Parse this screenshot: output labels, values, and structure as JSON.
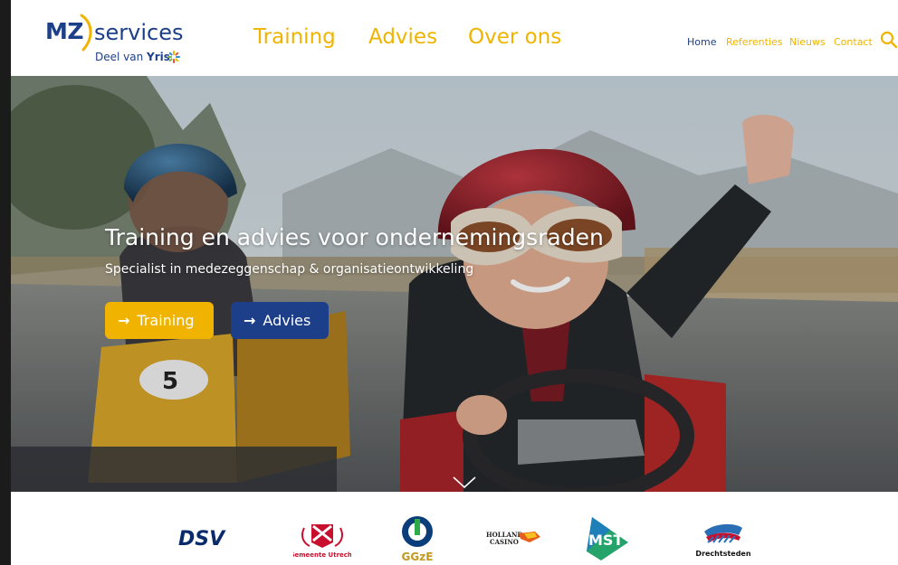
{
  "brand": {
    "mz": "MZ",
    "services": "services",
    "deel_van": "Deel van",
    "parent": "Yris"
  },
  "main_nav": [
    "Training",
    "Advies",
    "Over ons"
  ],
  "top_nav": [
    {
      "label": "Home",
      "active": true
    },
    {
      "label": "Referenties",
      "active": false
    },
    {
      "label": "Nieuws",
      "active": false
    },
    {
      "label": "Contact",
      "active": false
    }
  ],
  "search_icon": "search-icon",
  "hero": {
    "title": "Training en advies voor ondernemingsraden",
    "subtitle": "Specialist in medezeggenschap & organisatieontwikkeling",
    "buttons": [
      {
        "label": "Training",
        "icon": "arrow-right-icon"
      },
      {
        "label": "Advies",
        "icon": "arrow-right-icon"
      }
    ],
    "kart_number": "5",
    "scroll_icon": "chevron-down-icon"
  },
  "client_logos": {
    "dsv": "DSV",
    "utrecht": "Gemeente Utrecht",
    "ggze": "GGzE",
    "holland_casino": [
      "HOLLAND",
      "CASINO"
    ],
    "mst": "MST",
    "drechtsteden": "Drechtsteden"
  },
  "colors": {
    "brand_yellow": "#f0b400",
    "brand_blue": "#1d3f8a",
    "active_nav": "#1d3f8a"
  }
}
